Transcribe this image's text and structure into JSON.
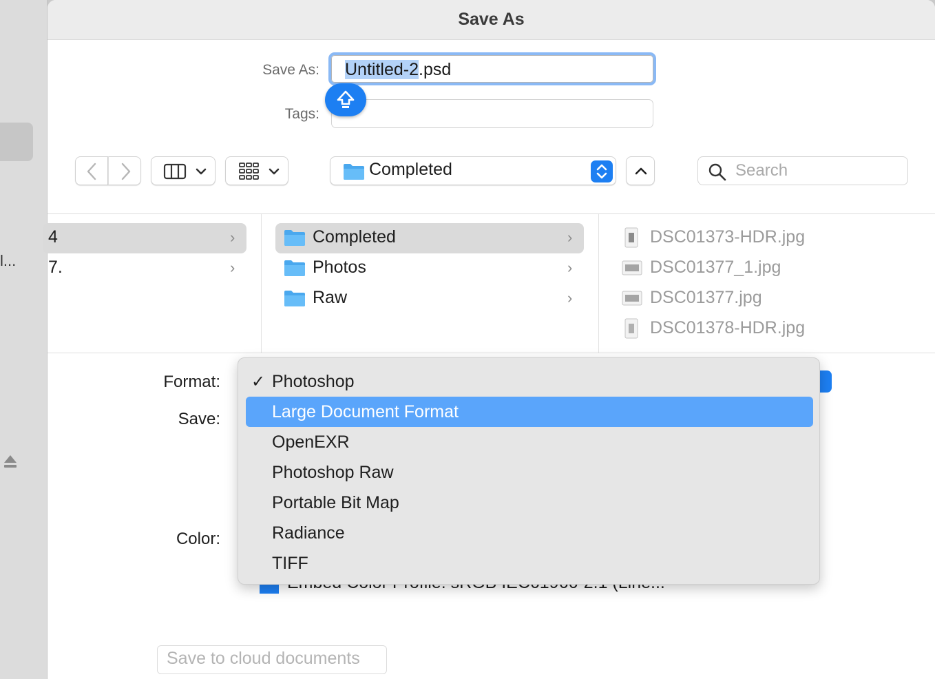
{
  "window": {
    "title": "Save As"
  },
  "sidebar": {
    "truncated_label": "l...",
    "eject_icon": "eject-icon"
  },
  "form": {
    "save_as_label": "Save As:",
    "filename_selected": "Untitled-2",
    "filename_ext": ".psd",
    "tags_label": "Tags:",
    "tags_value": ""
  },
  "toolbar": {
    "location": "Completed",
    "search_placeholder": "Search"
  },
  "browser": {
    "column1": [
      {
        "label": "4",
        "selected": true
      },
      {
        "label": "7.",
        "selected": false
      }
    ],
    "column2": [
      {
        "label": "Completed",
        "selected": true
      },
      {
        "label": "Photos",
        "selected": false
      },
      {
        "label": "Raw",
        "selected": false
      }
    ],
    "column3": [
      "DSC01373-HDR.jpg",
      "DSC01377_1.jpg",
      "DSC01377.jpg",
      "DSC01378-HDR.jpg"
    ]
  },
  "options": {
    "format_label": "Format:",
    "save_label": "Save:",
    "color_label": "Color:",
    "embed_profile_text": "Embed Color Profile:  sRGB IEC61966-2.1 (Line...",
    "embed_profile_checked": true
  },
  "format_menu": {
    "checked": "Photoshop",
    "highlighted": "Large Document Format",
    "items": [
      "Photoshop",
      "Large Document Format",
      "OpenEXR",
      "Photoshop Raw",
      "Portable Bit Map",
      "Radiance",
      "TIFF"
    ]
  },
  "footer": {
    "cloud_button": "Save to cloud documents"
  },
  "colors": {
    "accent": "#1d7ff2",
    "menu_highlight": "#5aa5fb"
  }
}
